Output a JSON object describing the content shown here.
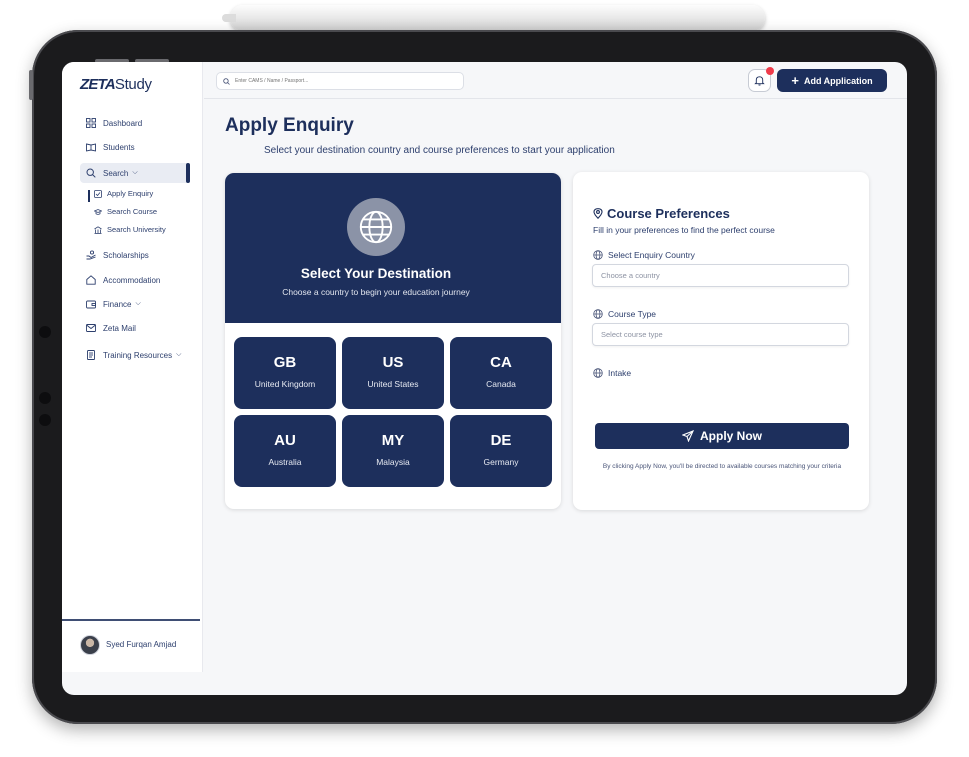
{
  "brand": {
    "logo_bold": "ZETA",
    "logo_rest": "Study"
  },
  "search": {
    "placeholder": "Enter CAMS / Name / Passport..."
  },
  "header": {
    "add_application_label": "Add Application"
  },
  "sidebar": {
    "items": [
      {
        "label": "Dashboard",
        "icon": "dashboard-icon"
      },
      {
        "label": "Students",
        "icon": "book-icon"
      },
      {
        "label": "Search",
        "icon": "search-icon"
      },
      {
        "label": "Scholarships",
        "icon": "scholarship-icon"
      },
      {
        "label": "Accommodation",
        "icon": "home-icon"
      },
      {
        "label": "Finance",
        "icon": "wallet-icon"
      },
      {
        "label": "Zeta Mail",
        "icon": "mail-icon"
      },
      {
        "label": "Training Resources",
        "icon": "document-icon"
      }
    ],
    "search_subitems": [
      {
        "label": "Apply Enquiry",
        "icon": "form-icon"
      },
      {
        "label": "Search Course",
        "icon": "graduation-cap-icon"
      },
      {
        "label": "Search University",
        "icon": "building-icon"
      }
    ],
    "user_name": "Syed Furqan Amjad"
  },
  "page": {
    "title": "Apply Enquiry",
    "subtitle": "Select your destination country and course preferences to start your application"
  },
  "destination": {
    "title": "Select Your Destination",
    "subtitle": "Choose a country to begin your education journey",
    "countries": [
      {
        "code": "GB",
        "name": "United Kingdom"
      },
      {
        "code": "US",
        "name": "United States"
      },
      {
        "code": "CA",
        "name": "Canada"
      },
      {
        "code": "AU",
        "name": "Australia"
      },
      {
        "code": "MY",
        "name": "Malaysia"
      },
      {
        "code": "DE",
        "name": "Germany"
      }
    ]
  },
  "preferences": {
    "title": "Course Preferences",
    "subtitle": "Fill in your preferences to find the perfect course",
    "country_label": "Select Enquiry Country",
    "country_placeholder": "Choose a country",
    "course_type_label": "Course Type",
    "course_type_placeholder": "Select course type",
    "intake_label": "Intake",
    "apply_label": "Apply Now",
    "apply_note": "By clicking Apply Now, you'll be directed to available courses matching your criteria"
  },
  "colors": {
    "primary": "#1d2f5c",
    "background": "#f6f7f9",
    "notification": "#ef3b4a"
  }
}
